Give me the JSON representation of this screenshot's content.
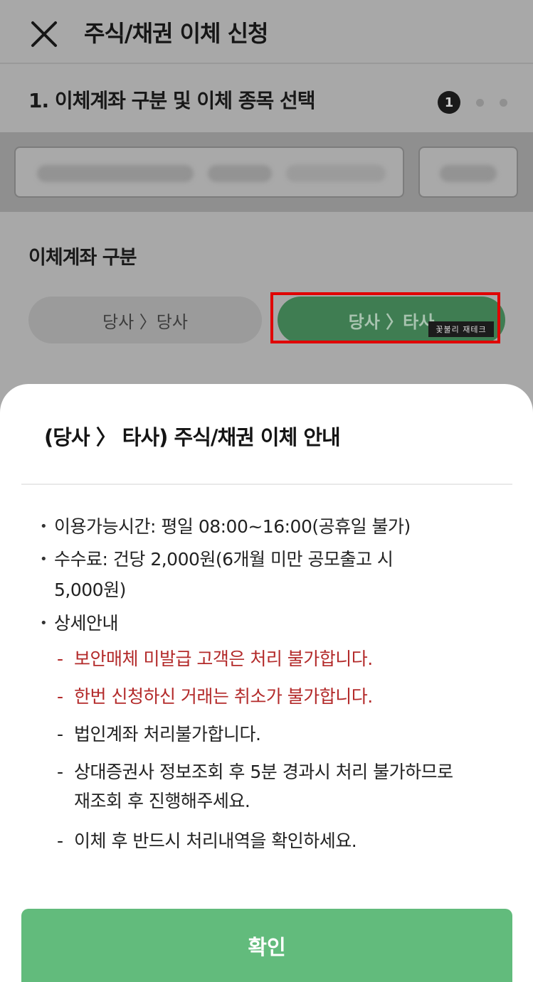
{
  "header": {
    "title": "주식/채권 이체 신청"
  },
  "step": {
    "title": "1. 이체계좌 구분 및 이체 종목 선택",
    "current": "1",
    "total_steps": 3
  },
  "transfer_type": {
    "label": "이체계좌 구분",
    "options": [
      "당사 〉당사",
      "당사 〉타사"
    ],
    "selected_index": 1
  },
  "watermark": "꽃불리 재테크",
  "sheet": {
    "title": "(당사 〉 타사) 주식/채권 이체 안내",
    "hours": "이용가능시간: 평일 08:00~16:00(공휴일 불가)",
    "fee_line1": "수수료: 건당 2,000원(6개월 미만 공모출고 시",
    "fee_line2": "5,000원)",
    "details_label": "상세안내",
    "details": [
      "보안매체 미발급 고객은 처리 불가합니다.",
      "한번 신청하신 거래는 취소가 불가합니다.",
      "법인계좌 처리불가합니다.",
      "상대증권사 정보조회 후 5분 경과시 처리 불가하므로",
      "재조회 후 진행해주세요.",
      "이체 후 반드시 처리내역을 확인하세요."
    ],
    "confirm_label": "확인"
  },
  "colors": {
    "accent_green": "#62bb7c",
    "selected_green_dimmed": "#3f7d52",
    "warning_red": "#b32a2a",
    "highlight_red": "#e00000"
  }
}
